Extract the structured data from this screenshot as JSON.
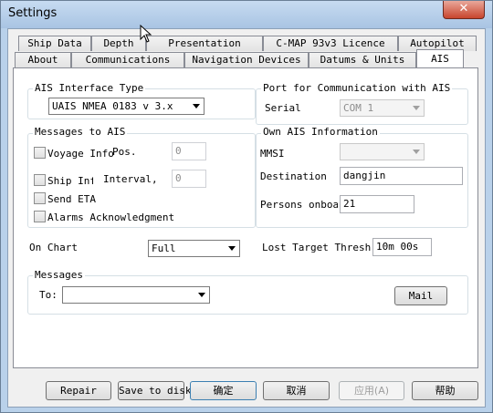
{
  "window": {
    "title": "Settings",
    "close_glyph": "✕"
  },
  "tabs_row1": [
    {
      "label": "Ship Data"
    },
    {
      "label": "Depth"
    },
    {
      "label": "Presentation"
    },
    {
      "label": "C-MAP 93v3 Licence"
    },
    {
      "label": "Autopilot"
    }
  ],
  "tabs_row2": [
    {
      "label": "About"
    },
    {
      "label": "Communications"
    },
    {
      "label": "Navigation Devices"
    },
    {
      "label": "Datums & Units"
    },
    {
      "label": "AIS",
      "active": true
    }
  ],
  "ais_interface": {
    "group_label": "AIS Interface Type",
    "value": "UAIS NMEA 0183 v 3.x"
  },
  "port": {
    "group_label": "Port for Communication with AIS",
    "serial_label": "Serial",
    "serial_value": "COM 1"
  },
  "messages_to_ais": {
    "group_label": "Messages to AIS",
    "voyage_info": "Voyage Info",
    "pos_label": "Pos.",
    "pos_value": "0",
    "ship_info": "Ship Info",
    "interval_label": "Interval,",
    "interval_value": "0",
    "send_eta": "Send ETA",
    "alarms_ack": "Alarms Acknowledgment"
  },
  "own_ais": {
    "group_label": "Own AIS Information",
    "mmsi_label": "MMSI",
    "mmsi_value": "",
    "destination_label": "Destination",
    "destination_value": "dangjin",
    "persons_label": "Persons onboard",
    "persons_value": "21"
  },
  "on_chart": {
    "label": "On Chart",
    "value": "Full"
  },
  "lost_target": {
    "label": "Lost Target Threshold",
    "value": "10m 00s"
  },
  "messages": {
    "group_label": "Messages",
    "to_label": "To:",
    "to_value": "",
    "mail_button": "Mail"
  },
  "footer": {
    "repair": "Repair",
    "save_to_disk": "Save to disk",
    "ok": "确定",
    "cancel": "取消",
    "apply": "应用(A)",
    "help": "帮助"
  }
}
